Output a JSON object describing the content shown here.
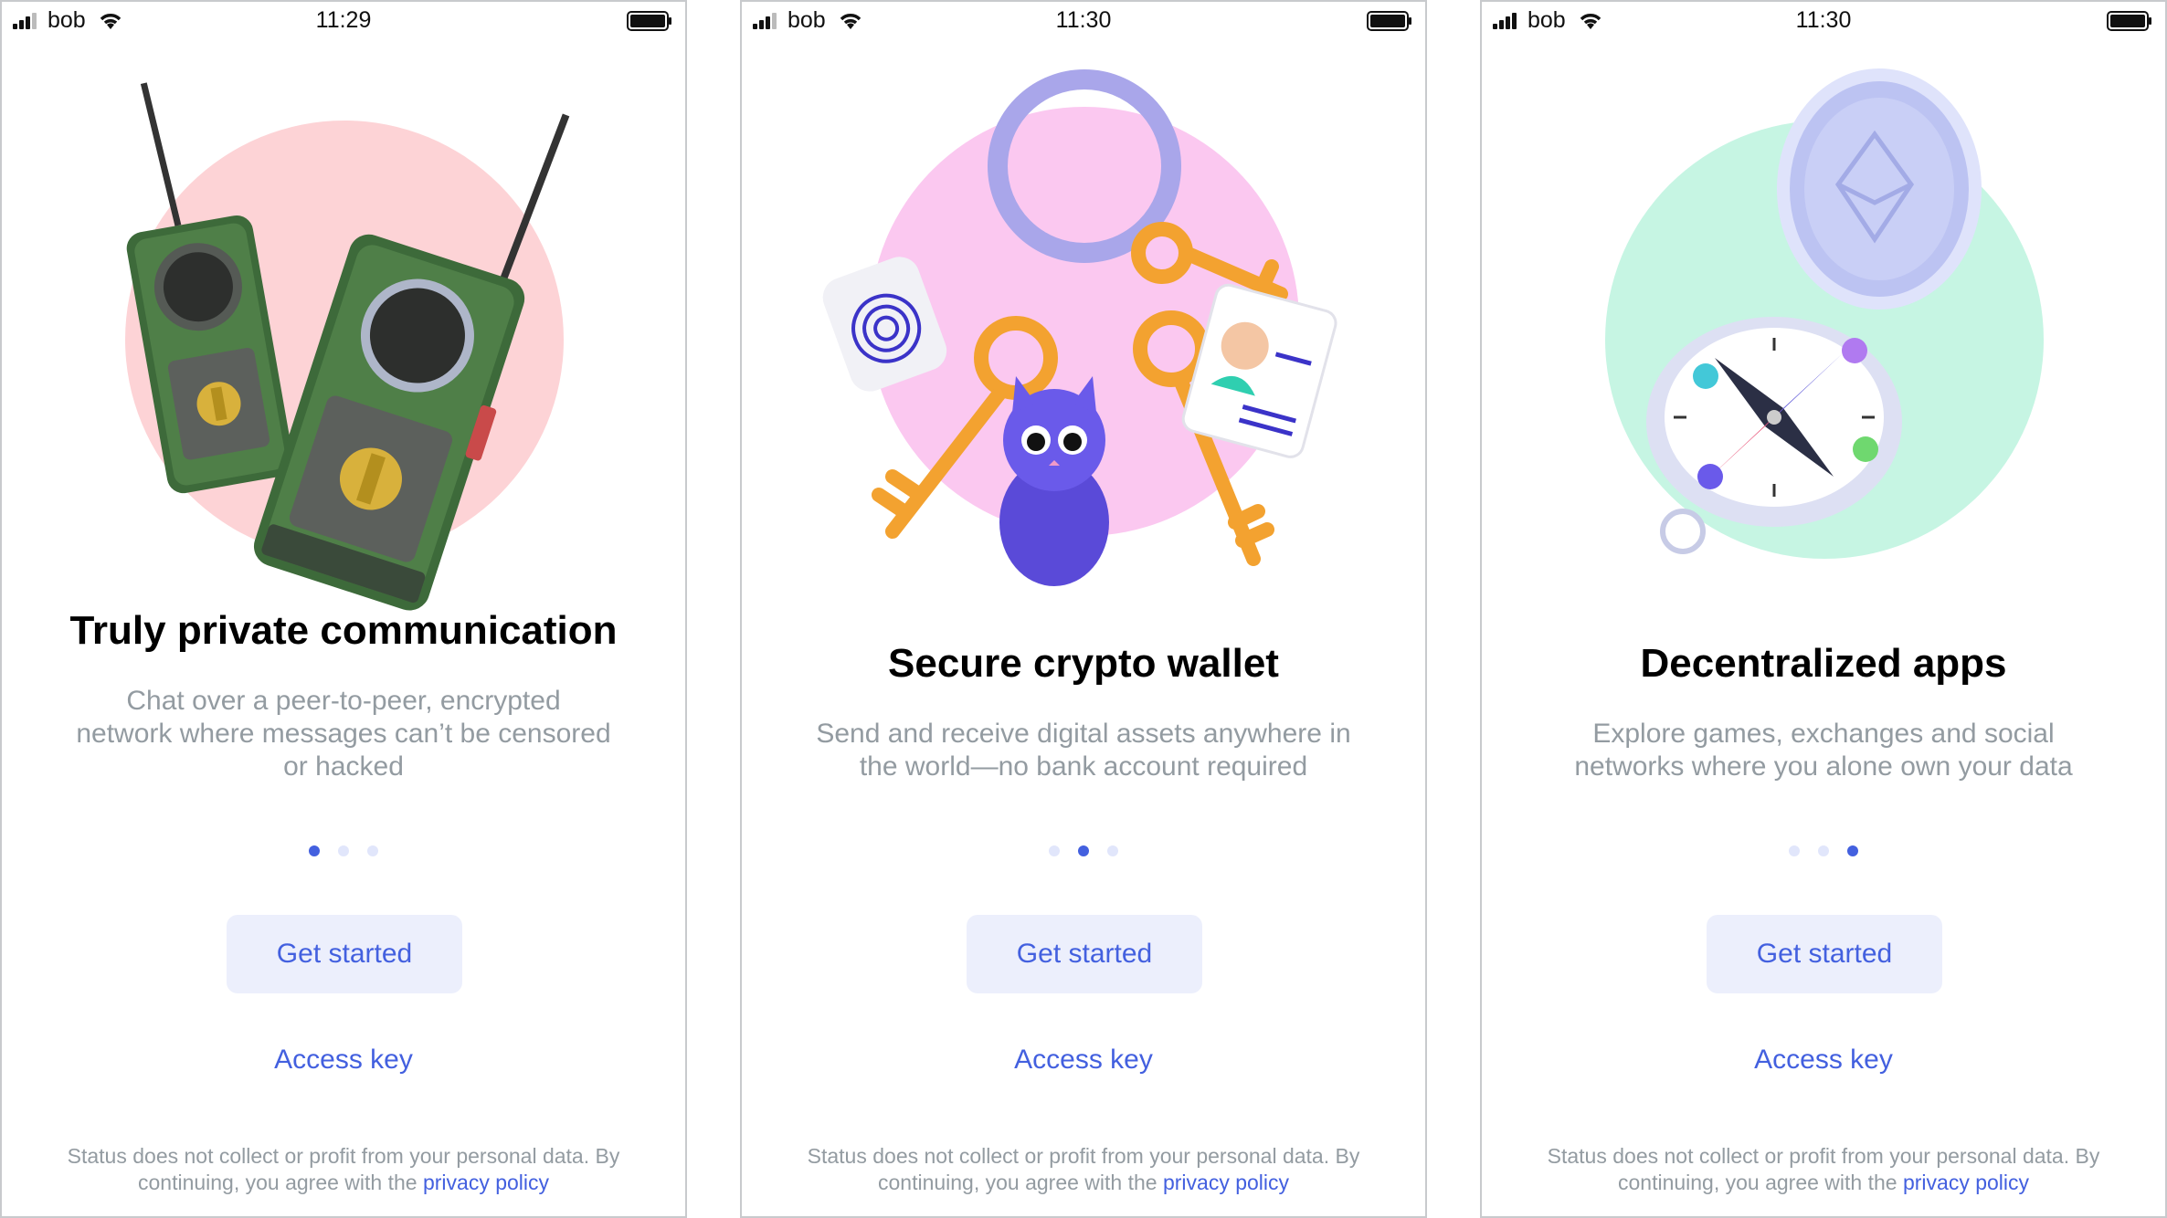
{
  "status_bar": {
    "carrier": "bob"
  },
  "screens": [
    {
      "time": "11:29",
      "title": "Truly private communication",
      "description": "Chat over a peer-to-peer, encrypted network where messages can’t be censored or hacked",
      "illustration": "walkie-talkies",
      "circle_color": "#fdd3d6",
      "active_dot": 1
    },
    {
      "time": "11:30",
      "title": "Secure crypto wallet",
      "description": "Send and receive digital assets anywhere in the world—no bank account required",
      "illustration": "keyring",
      "circle_color": "#fbc8f0",
      "active_dot": 2
    },
    {
      "time": "11:30",
      "title": "Decentralized apps",
      "description": "Explore games, exchanges and social networks where you alone own your data",
      "illustration": "compass",
      "circle_color": "#c6f5e3",
      "active_dot": 3
    }
  ],
  "buttons": {
    "get_started": "Get started",
    "access_key": "Access key"
  },
  "footer": {
    "text": "Status does not collect or profit from your personal data. By continuing, you agree with the",
    "link": "privacy policy"
  },
  "colors": {
    "accent": "#4360df",
    "button_bg": "#eceffc",
    "muted": "#939ba1"
  }
}
